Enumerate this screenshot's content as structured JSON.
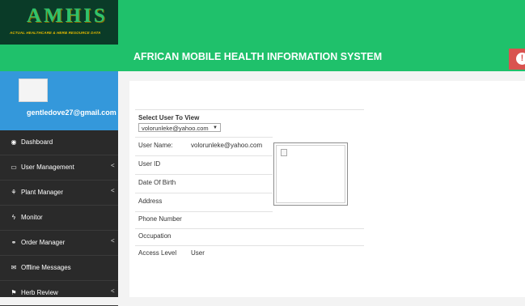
{
  "header": {
    "logo_text": "AMHIS",
    "logo_subtitle": "ACTUAL HEALTHCARE & HERB RESOURCE DATA",
    "title": "AFRICAN MOBILE HEALTH INFORMATION SYSTEM",
    "alert_icon": "!"
  },
  "profile": {
    "email": "gentledove27@gmail.com"
  },
  "sidebar": {
    "items": [
      {
        "label": "Dashboard",
        "icon": "dashboard-icon",
        "glyph": "◉",
        "has_submenu": false
      },
      {
        "label": "User Management",
        "icon": "desktop-icon",
        "glyph": "▭",
        "has_submenu": true
      },
      {
        "label": "Plant Manager",
        "icon": "plant-icon",
        "glyph": "⚘",
        "has_submenu": true
      },
      {
        "label": "Monitor",
        "icon": "bolt-icon",
        "glyph": "ϟ",
        "has_submenu": false
      },
      {
        "label": "Order Manager",
        "icon": "bicycle-icon",
        "glyph": "⚭",
        "has_submenu": true
      },
      {
        "label": "Offline Messages",
        "icon": "envelope-icon",
        "glyph": "✉",
        "has_submenu": false
      },
      {
        "label": "Herb Review",
        "icon": "review-icon",
        "glyph": "⚑",
        "has_submenu": true
      }
    ],
    "chevron": "<"
  },
  "form": {
    "select_label": "Select User To View",
    "selected_user": "volorunleke@yahoo.com",
    "fields": [
      {
        "label": "User Name:",
        "value": "volorunleke@yahoo.com"
      },
      {
        "label": "User ID",
        "value": ""
      },
      {
        "label": "Date Of Birth",
        "value": ""
      },
      {
        "label": "Address",
        "value": ""
      },
      {
        "label": "Phone Number",
        "value": ""
      },
      {
        "label": "Occupation",
        "value": ""
      },
      {
        "label": "Access Level",
        "value": "User"
      }
    ]
  },
  "colors": {
    "topbar": "#1fc16b",
    "logo_bg": "#0a3b28",
    "profile_bg": "#3498db",
    "sidebar_bg": "#2a2a2a",
    "alert": "#d9534f"
  }
}
